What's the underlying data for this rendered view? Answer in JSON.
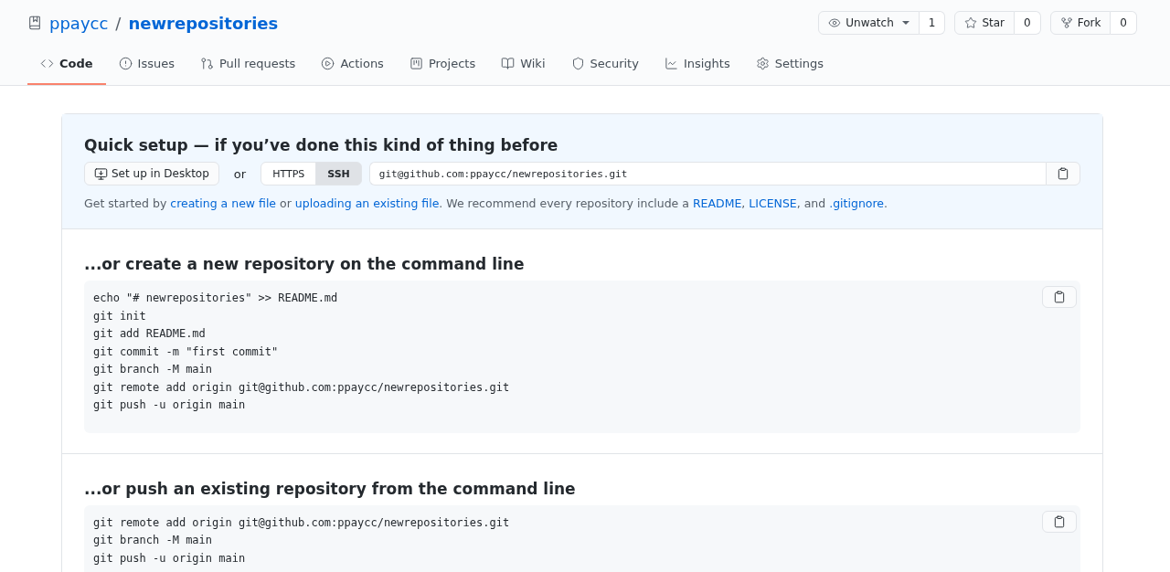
{
  "repo": {
    "owner": "ppaycc",
    "separator": "/",
    "name": "newrepositories"
  },
  "actions": [
    {
      "kind": "watch",
      "label": "Unwatch",
      "count": "1"
    },
    {
      "kind": "star",
      "label": "Star",
      "count": "0"
    },
    {
      "kind": "fork",
      "label": "Fork",
      "count": "0"
    }
  ],
  "tabs": [
    {
      "kind": "code",
      "label": "Code",
      "selected": true
    },
    {
      "kind": "issues",
      "label": "Issues",
      "selected": false
    },
    {
      "kind": "pulls",
      "label": "Pull requests",
      "selected": false
    },
    {
      "kind": "actions",
      "label": "Actions",
      "selected": false
    },
    {
      "kind": "projects",
      "label": "Projects",
      "selected": false
    },
    {
      "kind": "wiki",
      "label": "Wiki",
      "selected": false
    },
    {
      "kind": "security",
      "label": "Security",
      "selected": false
    },
    {
      "kind": "insights",
      "label": "Insights",
      "selected": false
    },
    {
      "kind": "settings",
      "label": "Settings",
      "selected": false
    }
  ],
  "quick_setup": {
    "title": "Quick setup — if you’ve done this kind of thing before",
    "desktop_button": "Set up in Desktop",
    "or": "or",
    "protocols": [
      {
        "label": "HTTPS",
        "selected": false
      },
      {
        "label": "SSH",
        "selected": true
      }
    ],
    "url": "git@github.com:ppaycc/newrepositories.git",
    "hint": [
      {
        "kind": "text",
        "text": "Get started by "
      },
      {
        "kind": "link",
        "text": "creating a new file"
      },
      {
        "kind": "text",
        "text": " or "
      },
      {
        "kind": "link",
        "text": "uploading an existing file"
      },
      {
        "kind": "text",
        "text": ". We recommend every repository include a "
      },
      {
        "kind": "link",
        "text": "README"
      },
      {
        "kind": "text",
        "text": ", "
      },
      {
        "kind": "link",
        "text": "LICENSE"
      },
      {
        "kind": "text",
        "text": ", and "
      },
      {
        "kind": "link",
        "text": ".gitignore"
      },
      {
        "kind": "text",
        "text": "."
      }
    ]
  },
  "sections": [
    {
      "title": "...or create a new repository on the command line",
      "lines": [
        "echo \"# newrepositories\" >> README.md",
        "git init",
        "git add README.md",
        "git commit -m \"first commit\"",
        "git branch -M main",
        "git remote add origin git@github.com:ppaycc/newrepositories.git",
        "git push -u origin main"
      ]
    },
    {
      "title": "...or push an existing repository from the command line",
      "lines": [
        "git remote add origin git@github.com:ppaycc/newrepositories.git",
        "git branch -M main",
        "git push -u origin main"
      ]
    }
  ]
}
